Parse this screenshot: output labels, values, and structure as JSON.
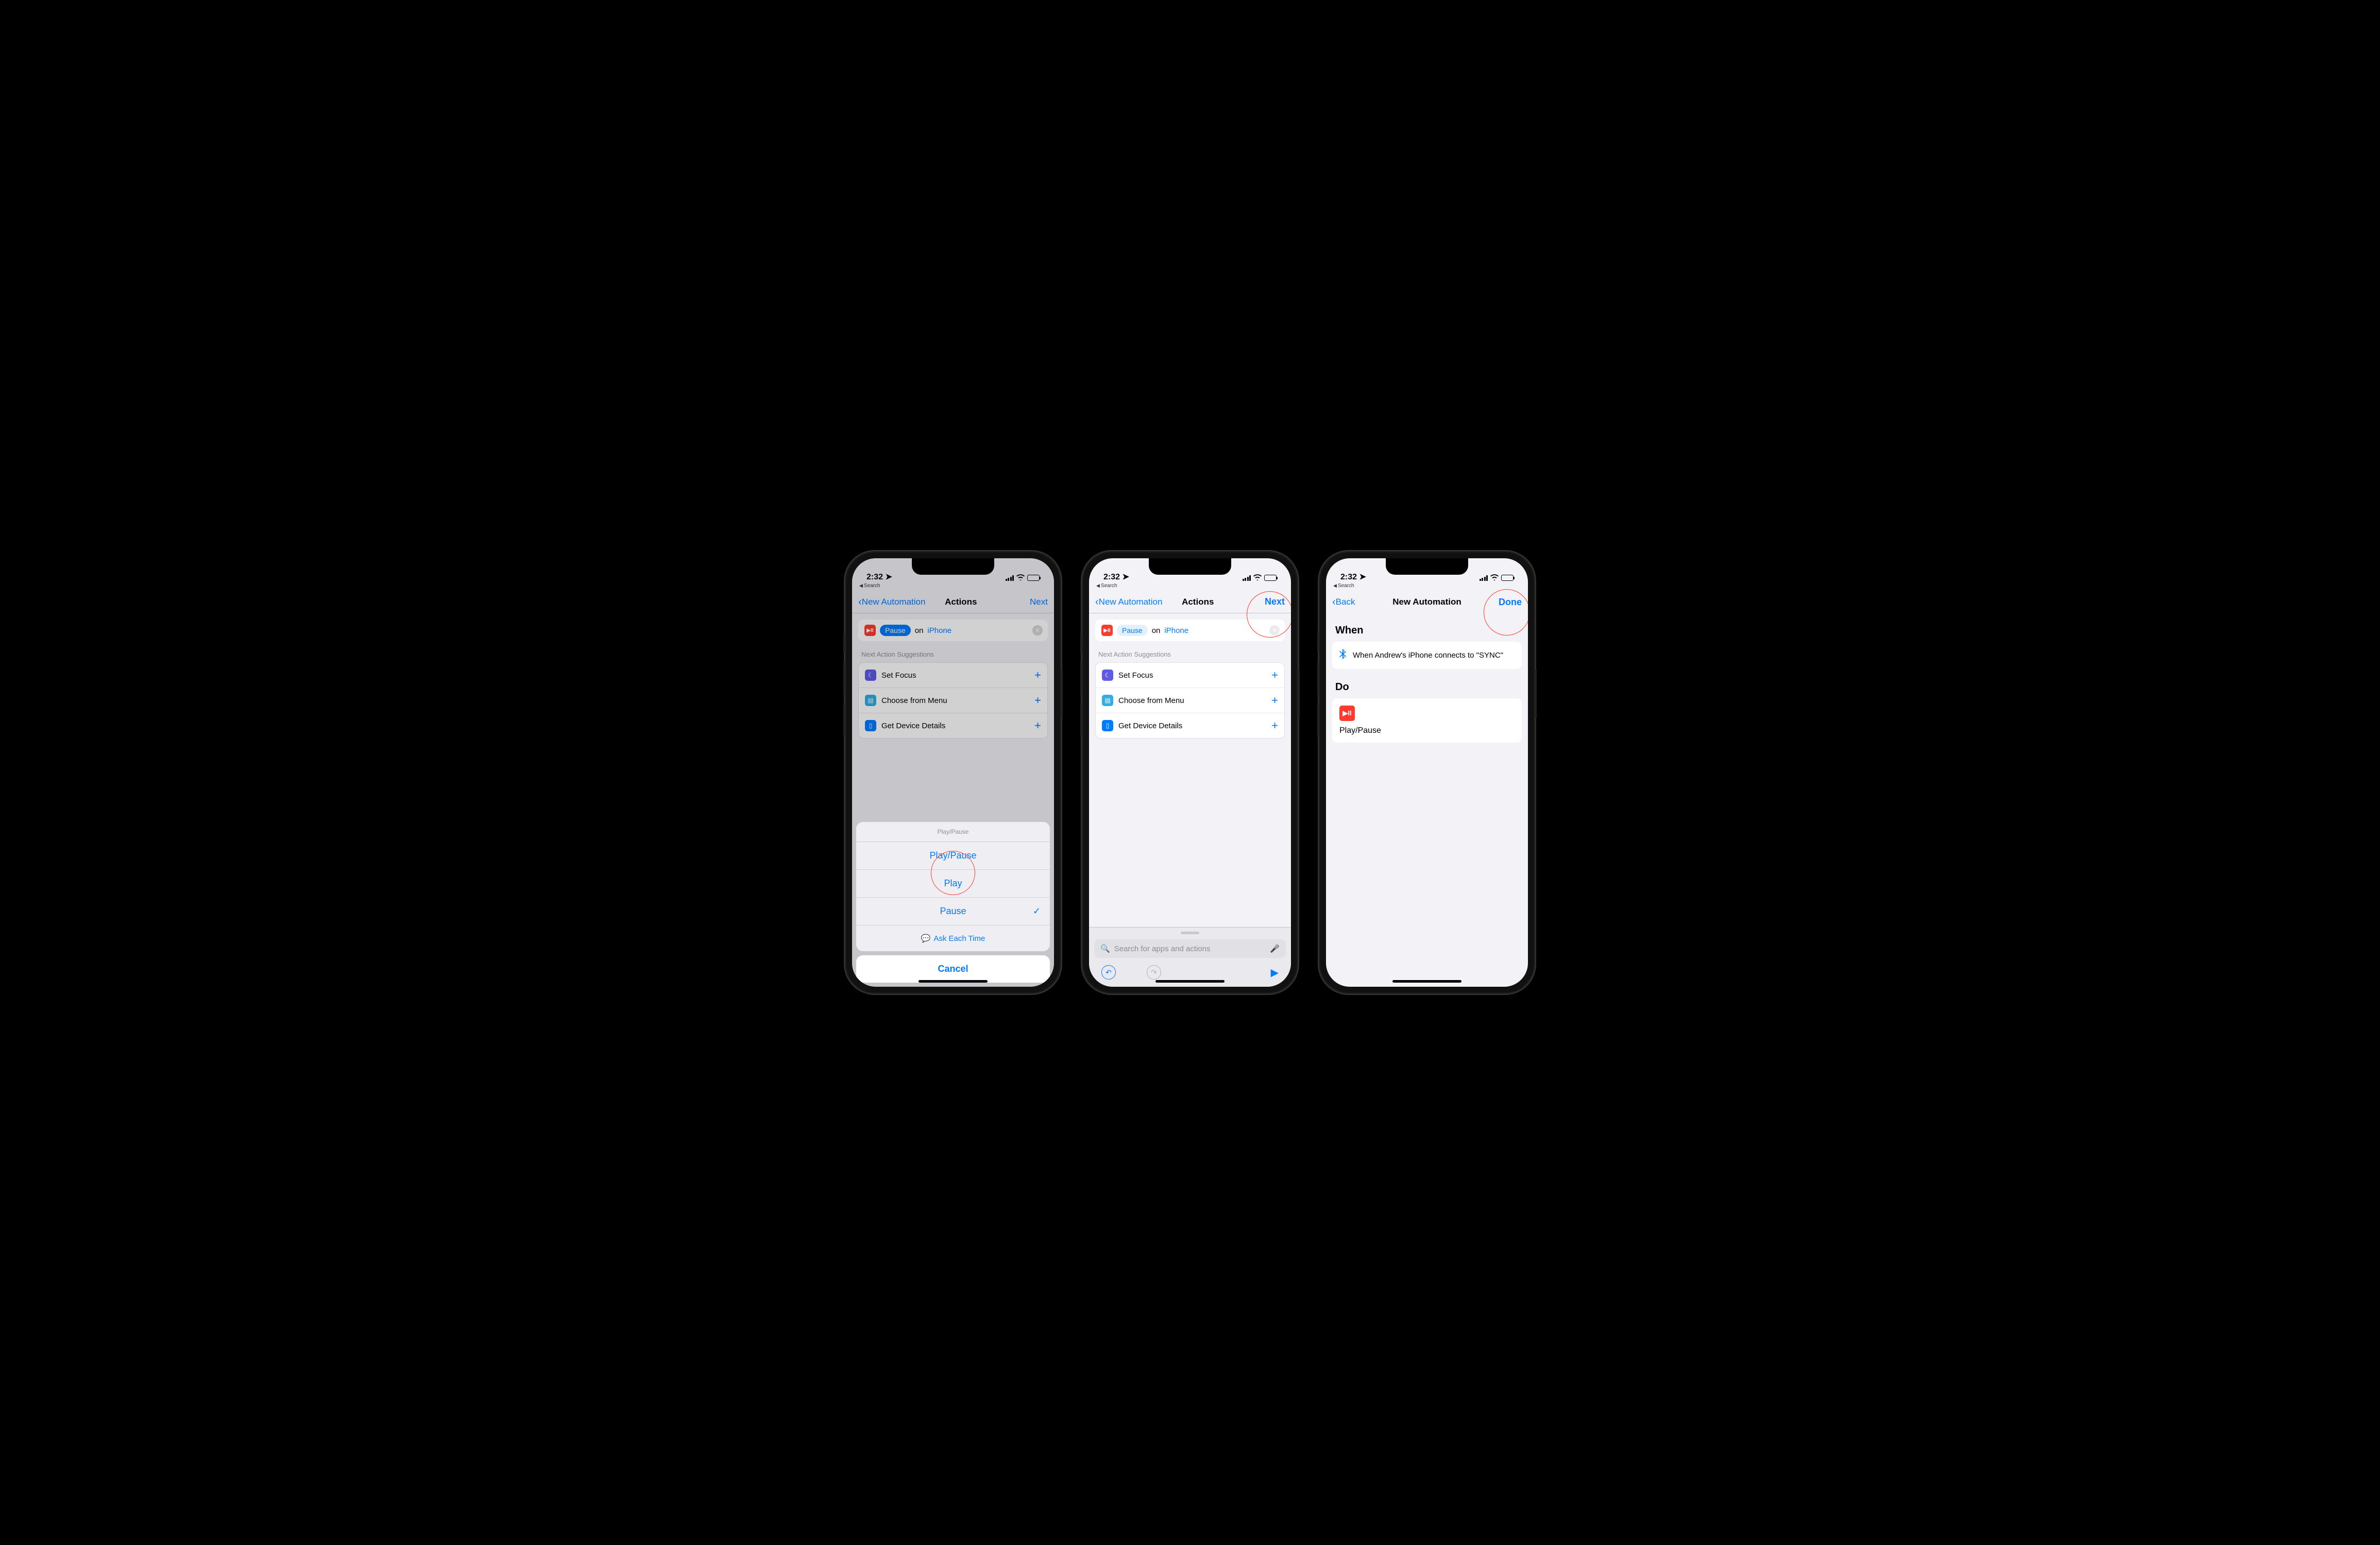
{
  "status": {
    "time": "2:32",
    "back_app": "Search"
  },
  "screen1": {
    "nav": {
      "back": "New Automation",
      "title": "Actions",
      "next": "Next"
    },
    "action": {
      "pill": "Pause",
      "on": "on",
      "device": "iPhone"
    },
    "suggestions_label": "Next Action Suggestions",
    "suggestions": [
      {
        "label": "Set Focus"
      },
      {
        "label": "Choose from Menu"
      },
      {
        "label": "Get Device Details"
      }
    ],
    "sheet": {
      "header": "Play/Pause",
      "opt_playpause": "Play/Pause",
      "opt_play": "Play",
      "opt_pause": "Pause",
      "opt_ask": "Ask Each Time",
      "cancel": "Cancel"
    }
  },
  "screen2": {
    "nav": {
      "back": "New Automation",
      "title": "Actions",
      "next": "Next"
    },
    "action": {
      "pill": "Pause",
      "on": "on",
      "device": "iPhone"
    },
    "suggestions_label": "Next Action Suggestions",
    "suggestions": [
      {
        "label": "Set Focus"
      },
      {
        "label": "Choose from Menu"
      },
      {
        "label": "Get Device Details"
      }
    ],
    "search_placeholder": "Search for apps and actions"
  },
  "screen3": {
    "nav": {
      "back": "Back",
      "title": "New Automation",
      "done": "Done"
    },
    "when_title": "When",
    "when_text": "When Andrew's iPhone connects to \"SYNC\"",
    "do_title": "Do",
    "do_action": "Play/Pause"
  }
}
